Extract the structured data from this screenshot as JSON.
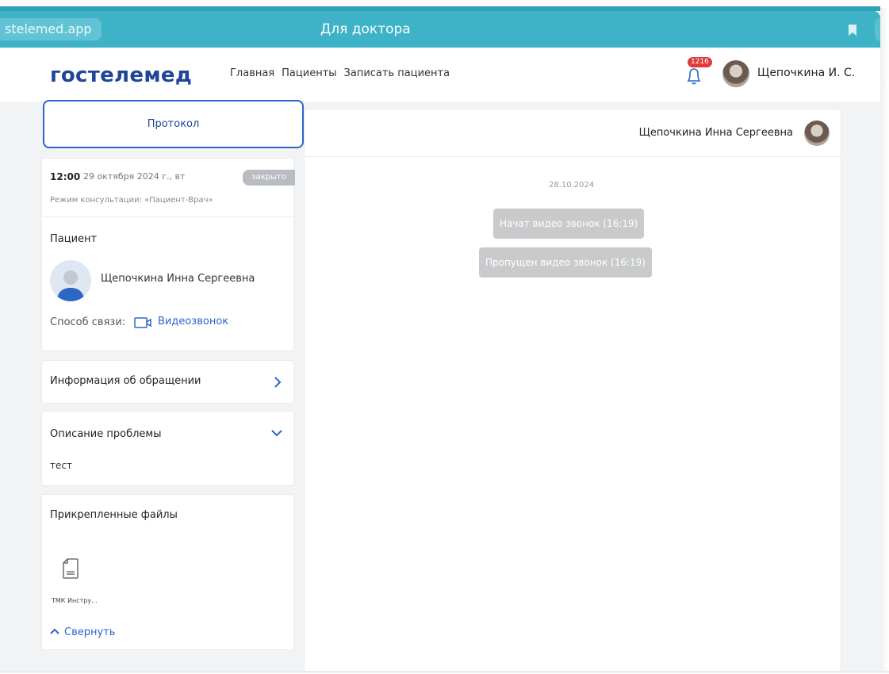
{
  "browser": {
    "url": "stelemed.app",
    "title": "Для доктора"
  },
  "header": {
    "logo": "гостелемед",
    "nav": [
      "Главная",
      "Пациенты",
      "Записать пациента"
    ],
    "notifications_count": "1216",
    "user_name": "Щепочкина И. С."
  },
  "sidebar": {
    "protocol_tab": "Протокол",
    "consultation": {
      "time": "12:00",
      "date": "29 октября 2024 г., вт",
      "status": "закрыто",
      "mode": "Режим консультации: «Пациент-Врач»"
    },
    "patient": {
      "section_title": "Пациент",
      "name": "Щепочкина Инна Сергеевна",
      "contact_label": "Способ связи:",
      "contact_value": "Видеозвонок"
    },
    "appeal_info": {
      "title": "Информация об обращении"
    },
    "problem": {
      "title": "Описание проблемы",
      "text": "тест"
    },
    "files": {
      "title": "Прикрепленные файлы",
      "items": [
        "ТМК Инстру..."
      ],
      "collapse_label": "Свернуть"
    }
  },
  "chat": {
    "user_name": "Щепочкина Инна Сергеевна",
    "date": "28.10.2024",
    "messages": [
      "Начат видео звонок (16:19)",
      "Пропущен видео звонок (16:19)"
    ]
  },
  "colors": {
    "browser_bar": "#3eb2c7",
    "brand": "#1f4597",
    "accent": "#2a66c9",
    "badge": "#e03a3a"
  }
}
